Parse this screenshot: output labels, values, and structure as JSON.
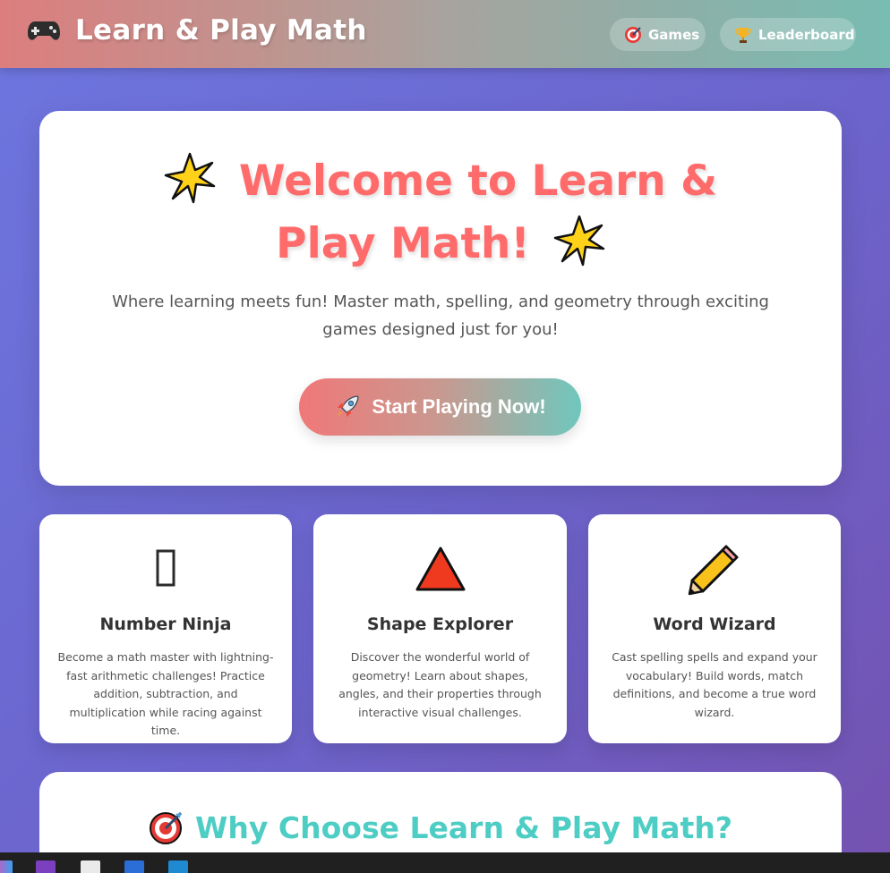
{
  "header": {
    "brand_icon": "gamepad-icon",
    "title": "Learn & Play Math",
    "nav": [
      {
        "label": "Games",
        "icon": "target-icon"
      },
      {
        "label": "Leaderboard",
        "icon": "trophy-icon"
      }
    ]
  },
  "hero": {
    "title": "Welcome to Learn & Play Math!",
    "subtitle": "Where learning meets fun! Master math, spelling, and geometry through exciting games designed just for you!",
    "cta_label": "Start Playing Now!",
    "cta_icon": "rocket-icon"
  },
  "cards": [
    {
      "icon": "missing-glyph-icon",
      "title": "Number Ninja",
      "description": "Become a math master with lightning-fast arithmetic challenges! Practice addition, subtraction, and multiplication while racing against time."
    },
    {
      "icon": "triangle-icon",
      "title": "Shape Explorer",
      "description": "Discover the wonderful world of geometry! Learn about shapes, angles, and their properties through interactive visual challenges."
    },
    {
      "icon": "pencil-icon",
      "title": "Word Wizard",
      "description": "Cast spelling spells and expand your vocabulary! Build words, match definitions, and become a true word wizard."
    }
  ],
  "why": {
    "title": "Why Choose Learn & Play Math?",
    "icon": "target-icon"
  },
  "colors": {
    "title_red": "#ff6b6b",
    "teal": "#4ecdc4",
    "header_left": "#dc7e7e",
    "header_right": "#78bcb2"
  },
  "taskbar": {
    "apps": [
      "app-icon",
      "onenote-icon",
      "app-icon",
      "word-icon",
      "vscode-icon"
    ]
  }
}
